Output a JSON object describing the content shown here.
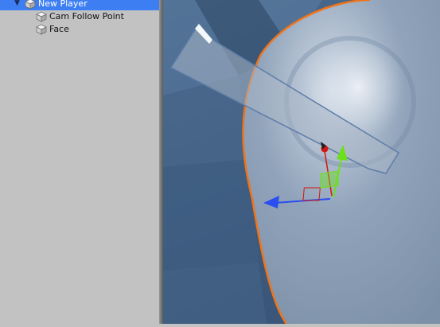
{
  "hierarchy": {
    "items": [
      {
        "label": "New Player",
        "icon": "gameobject-cube-icon",
        "selected": true,
        "expanded": true
      },
      {
        "label": "Cam Follow Point",
        "icon": "gameobject-cube-icon",
        "selected": false
      },
      {
        "label": "Face",
        "icon": "gameobject-cube-icon",
        "selected": false
      }
    ]
  },
  "scene": {
    "gizmo": {
      "x_axis_color": "#d4170f",
      "y_axis_color": "#6ce01a",
      "z_axis_color": "#2a4ef0"
    },
    "selection_outline_color": "#f07318"
  }
}
